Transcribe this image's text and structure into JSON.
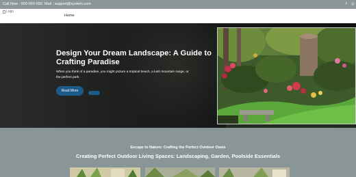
{
  "topbar": {
    "call": "Call Now : 000-000-000",
    "mail": "Mail : support@system.com",
    "social_icons": [
      "facebook-icon",
      "instagram-icon"
    ],
    "facebook_glyph": "f",
    "instagram_glyph": "◎"
  },
  "nav": {
    "logo_alt": "Logo",
    "items": [
      {
        "label": "Home"
      }
    ]
  },
  "hero": {
    "title": "Design Your Dream Landscape: A Guide to Crafting Paradise",
    "description": "When you think of a paradise, you might picture a tropical beach, a lush mountain range, or the perfect park.",
    "primary_button": "Read More",
    "secondary_button": "",
    "image_alt": "garden-photo"
  },
  "section": {
    "eyebrow": "Escape to Nature: Crafting the Perfect Outdoor Oasis",
    "heading": "Creating Perfect Outdoor Living Spaces: Landscaping, Garden, Poolside Essentials"
  },
  "colors": {
    "topbar_bg": "#8d9799",
    "hero_bg": "#1a1b1b",
    "button": "#1c5a8a",
    "section_bg": "#8a9597"
  }
}
